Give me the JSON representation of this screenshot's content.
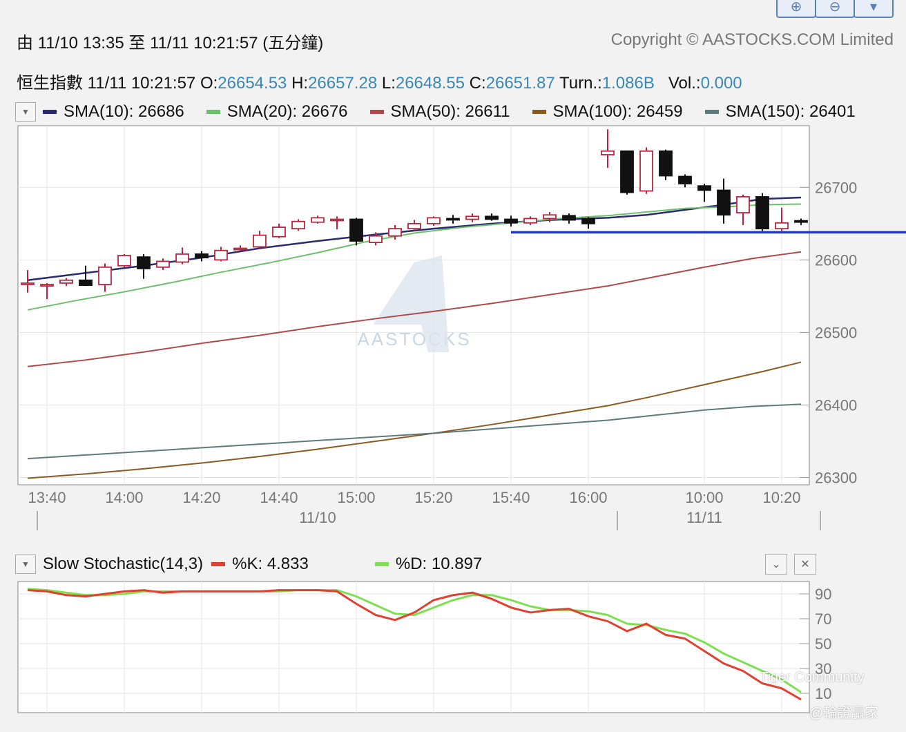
{
  "header": {
    "range_text": "由  11/10 13:35 至  11/11 10:21:57 (五分鐘)",
    "copyright": "Copyright © AASTOCKS.COM Limited"
  },
  "quote": {
    "name": "恒生指數",
    "time": "11/11 10:21:57",
    "o_label": "O:",
    "o": "26654.53",
    "h_label": "H:",
    "h": "26657.28",
    "l_label": "L:",
    "l": "26648.55",
    "c_label": "C:",
    "c": "26651.87",
    "turn_label": "Turn.:",
    "turn": "1.086B",
    "vol_label": "Vol.:",
    "vol": "0.000"
  },
  "legend": [
    {
      "label": "SMA(10): 26686",
      "color": "#2a2a6e"
    },
    {
      "label": "SMA(20): 26676",
      "color": "#6cc06c"
    },
    {
      "label": "SMA(50): 26611",
      "color": "#b04a4a"
    },
    {
      "label": "SMA(100): 26459",
      "color": "#8a5a20"
    },
    {
      "label": "SMA(150): 26401",
      "color": "#5f7a7a"
    }
  ],
  "stochastic": {
    "title": "Slow Stochastic(14,3)",
    "k_label": "%K: 4.833",
    "d_label": "%D: 10.897",
    "k_color": "#e04030",
    "d_color": "#7ee050"
  },
  "watermarks": {
    "center": "AASTOCKS",
    "corner1": "Tiger Community",
    "corner2": "@輪證贏家"
  },
  "chart_data": [
    {
      "type": "candlestick",
      "ylim": [
        26290,
        26785
      ],
      "yticks": [
        26700,
        26600,
        26500,
        26400,
        26300
      ],
      "x_ticks": [
        {
          "i": 1,
          "label": "13:40"
        },
        {
          "i": 5,
          "label": "14:00"
        },
        {
          "i": 9,
          "label": "14:20"
        },
        {
          "i": 13,
          "label": "14:40"
        },
        {
          "i": 17,
          "label": "15:00"
        },
        {
          "i": 21,
          "label": "15:20"
        },
        {
          "i": 25,
          "label": "15:40"
        },
        {
          "i": 29,
          "label": "16:00"
        },
        {
          "i": 35,
          "label": "10:00"
        },
        {
          "i": 39,
          "label": "10:20"
        }
      ],
      "date_labels": [
        {
          "i": 15,
          "label": "11/10"
        },
        {
          "i": 35,
          "label": "11/11"
        }
      ],
      "session_separators": [
        0.5,
        30.5,
        41
      ],
      "candles": [
        {
          "o": 26568,
          "h": 26586,
          "l": 26555,
          "c": 26568
        },
        {
          "o": 26565,
          "h": 26568,
          "l": 26546,
          "c": 26566
        },
        {
          "o": 26568,
          "h": 26575,
          "l": 26564,
          "c": 26572
        },
        {
          "o": 26572,
          "h": 26592,
          "l": 26564,
          "c": 26565
        },
        {
          "o": 26566,
          "h": 26595,
          "l": 26556,
          "c": 26590
        },
        {
          "o": 26592,
          "h": 26608,
          "l": 26590,
          "c": 26606
        },
        {
          "o": 26604,
          "h": 26608,
          "l": 26574,
          "c": 26588
        },
        {
          "o": 26590,
          "h": 26602,
          "l": 26586,
          "c": 26598
        },
        {
          "o": 26597,
          "h": 26617,
          "l": 26594,
          "c": 26608
        },
        {
          "o": 26608,
          "h": 26612,
          "l": 26598,
          "c": 26603
        },
        {
          "o": 26600,
          "h": 26618,
          "l": 26598,
          "c": 26613
        },
        {
          "o": 26615,
          "h": 26620,
          "l": 26613,
          "c": 26616
        },
        {
          "o": 26618,
          "h": 26640,
          "l": 26616,
          "c": 26634
        },
        {
          "o": 26632,
          "h": 26650,
          "l": 26630,
          "c": 26645
        },
        {
          "o": 26643,
          "h": 26656,
          "l": 26640,
          "c": 26653
        },
        {
          "o": 26652,
          "h": 26661,
          "l": 26650,
          "c": 26658
        },
        {
          "o": 26656,
          "h": 26660,
          "l": 26642,
          "c": 26656
        },
        {
          "o": 26656,
          "h": 26658,
          "l": 26620,
          "c": 26626
        },
        {
          "o": 26624,
          "h": 26638,
          "l": 26620,
          "c": 26633
        },
        {
          "o": 26633,
          "h": 26648,
          "l": 26628,
          "c": 26643
        },
        {
          "o": 26643,
          "h": 26655,
          "l": 26640,
          "c": 26650
        },
        {
          "o": 26650,
          "h": 26660,
          "l": 26647,
          "c": 26658
        },
        {
          "o": 26657,
          "h": 26662,
          "l": 26650,
          "c": 26656
        },
        {
          "o": 26656,
          "h": 26664,
          "l": 26652,
          "c": 26660
        },
        {
          "o": 26660,
          "h": 26664,
          "l": 26654,
          "c": 26656
        },
        {
          "o": 26656,
          "h": 26661,
          "l": 26646,
          "c": 26651
        },
        {
          "o": 26651,
          "h": 26660,
          "l": 26648,
          "c": 26657
        },
        {
          "o": 26657,
          "h": 26666,
          "l": 26652,
          "c": 26662
        },
        {
          "o": 26661,
          "h": 26664,
          "l": 26650,
          "c": 26655
        },
        {
          "o": 26657,
          "h": 26659,
          "l": 26643,
          "c": 26650
        },
        {
          "o": 26745,
          "h": 26780,
          "l": 26727,
          "c": 26750
        },
        {
          "o": 26750,
          "h": 26750,
          "l": 26690,
          "c": 26693
        },
        {
          "o": 26695,
          "h": 26755,
          "l": 26691,
          "c": 26750
        },
        {
          "o": 26750,
          "h": 26752,
          "l": 26710,
          "c": 26716
        },
        {
          "o": 26715,
          "h": 26718,
          "l": 26700,
          "c": 26705
        },
        {
          "o": 26702,
          "h": 26705,
          "l": 26680,
          "c": 26696
        },
        {
          "o": 26696,
          "h": 26712,
          "l": 26650,
          "c": 26662
        },
        {
          "o": 26665,
          "h": 26690,
          "l": 26648,
          "c": 26687
        },
        {
          "o": 26687,
          "h": 26692,
          "l": 26640,
          "c": 26643
        },
        {
          "o": 26643,
          "h": 26672,
          "l": 26640,
          "c": 26651
        },
        {
          "o": 26654,
          "h": 26657,
          "l": 26648,
          "c": 26652
        }
      ],
      "sma10": [
        26572,
        26582,
        26592,
        26603,
        26616,
        26626,
        26635,
        26643,
        26650,
        26655,
        26658,
        26662,
        26669,
        26676,
        26684,
        26686
      ],
      "sma20": [
        26531,
        26544,
        26556,
        26569,
        26583,
        26596,
        26610,
        26625,
        26637,
        26645,
        26651,
        26657,
        26661,
        26666,
        26671,
        26673,
        26676,
        26677
      ],
      "sma50": [
        26453,
        26462,
        26473,
        26485,
        26496,
        26508,
        26519,
        26529,
        26540,
        26552,
        26564,
        26577,
        26590,
        26602,
        26611
      ],
      "sma100": [
        26299,
        26305,
        26312,
        26320,
        26329,
        26339,
        26350,
        26361,
        26373,
        26386,
        26399,
        26410,
        26422,
        26434,
        26446,
        26459
      ],
      "sma150": [
        26326,
        26331,
        26336,
        26341,
        26346,
        26351,
        26356,
        26361,
        26367,
        26373,
        26379,
        26386,
        26393,
        26398,
        26401
      ],
      "sma_x": {
        "sma10": [
          0,
          3,
          6,
          9,
          12,
          15,
          18,
          21,
          24,
          27,
          30,
          32,
          34,
          36,
          38,
          40
        ],
        "sma20": [
          0,
          2.5,
          5,
          7.5,
          10,
          12.5,
          15,
          17.5,
          20,
          22.5,
          25,
          27.5,
          30,
          32,
          34,
          36,
          38,
          40
        ],
        "sma50": [
          0,
          3,
          6,
          9,
          12,
          15,
          18,
          21,
          24,
          27,
          30,
          32.5,
          35,
          37.5,
          40
        ],
        "sma100": [
          0,
          3,
          6,
          9,
          12,
          15,
          18,
          21,
          24,
          27,
          30,
          32,
          34,
          36,
          38,
          40
        ],
        "sma150": [
          0,
          3,
          6,
          9,
          12,
          15,
          18,
          21,
          24,
          27,
          30,
          32.5,
          35,
          37.5,
          40
        ]
      },
      "hline": {
        "y": 26638,
        "from_i": 25,
        "color": "#1a35d8"
      }
    },
    {
      "type": "line",
      "title": "Slow Stochastic(14,3)",
      "ylim": [
        0,
        100
      ],
      "yticks": [
        90,
        70,
        50,
        30,
        10
      ],
      "series": [
        {
          "name": "%K",
          "color": "#e04030",
          "x": [
            0,
            1,
            2,
            3,
            4,
            5,
            6,
            7,
            8,
            9,
            10,
            11,
            12,
            13,
            14,
            15,
            16,
            17,
            18,
            19,
            20,
            21,
            22,
            23,
            24,
            25,
            26,
            27,
            28,
            29,
            30,
            31,
            32,
            33,
            34,
            35,
            36,
            37,
            38,
            39,
            40
          ],
          "values": [
            93,
            92,
            89,
            88,
            90,
            92,
            93,
            91,
            92,
            92,
            92,
            92,
            92,
            93,
            93,
            93,
            92,
            82,
            73,
            69,
            75,
            85,
            89,
            91,
            86,
            79,
            75,
            77,
            78,
            72,
            68,
            60,
            66,
            57,
            54,
            44,
            34,
            28,
            18,
            14,
            5
          ]
        },
        {
          "name": "%D",
          "color": "#7ee050",
          "x": [
            0,
            1,
            2,
            3,
            4,
            5,
            6,
            7,
            8,
            9,
            10,
            11,
            12,
            13,
            14,
            15,
            16,
            17,
            18,
            19,
            20,
            21,
            22,
            23,
            24,
            25,
            26,
            27,
            28,
            29,
            30,
            31,
            32,
            33,
            34,
            35,
            36,
            37,
            38,
            39,
            40
          ],
          "values": [
            94,
            93,
            91,
            89,
            89,
            90,
            92,
            92,
            92,
            92,
            92,
            92,
            92,
            92,
            93,
            93,
            93,
            88,
            81,
            74,
            73,
            79,
            85,
            89,
            89,
            85,
            80,
            77,
            77,
            76,
            73,
            66,
            65,
            61,
            58,
            51,
            42,
            35,
            28,
            21,
            11
          ]
        }
      ]
    }
  ]
}
